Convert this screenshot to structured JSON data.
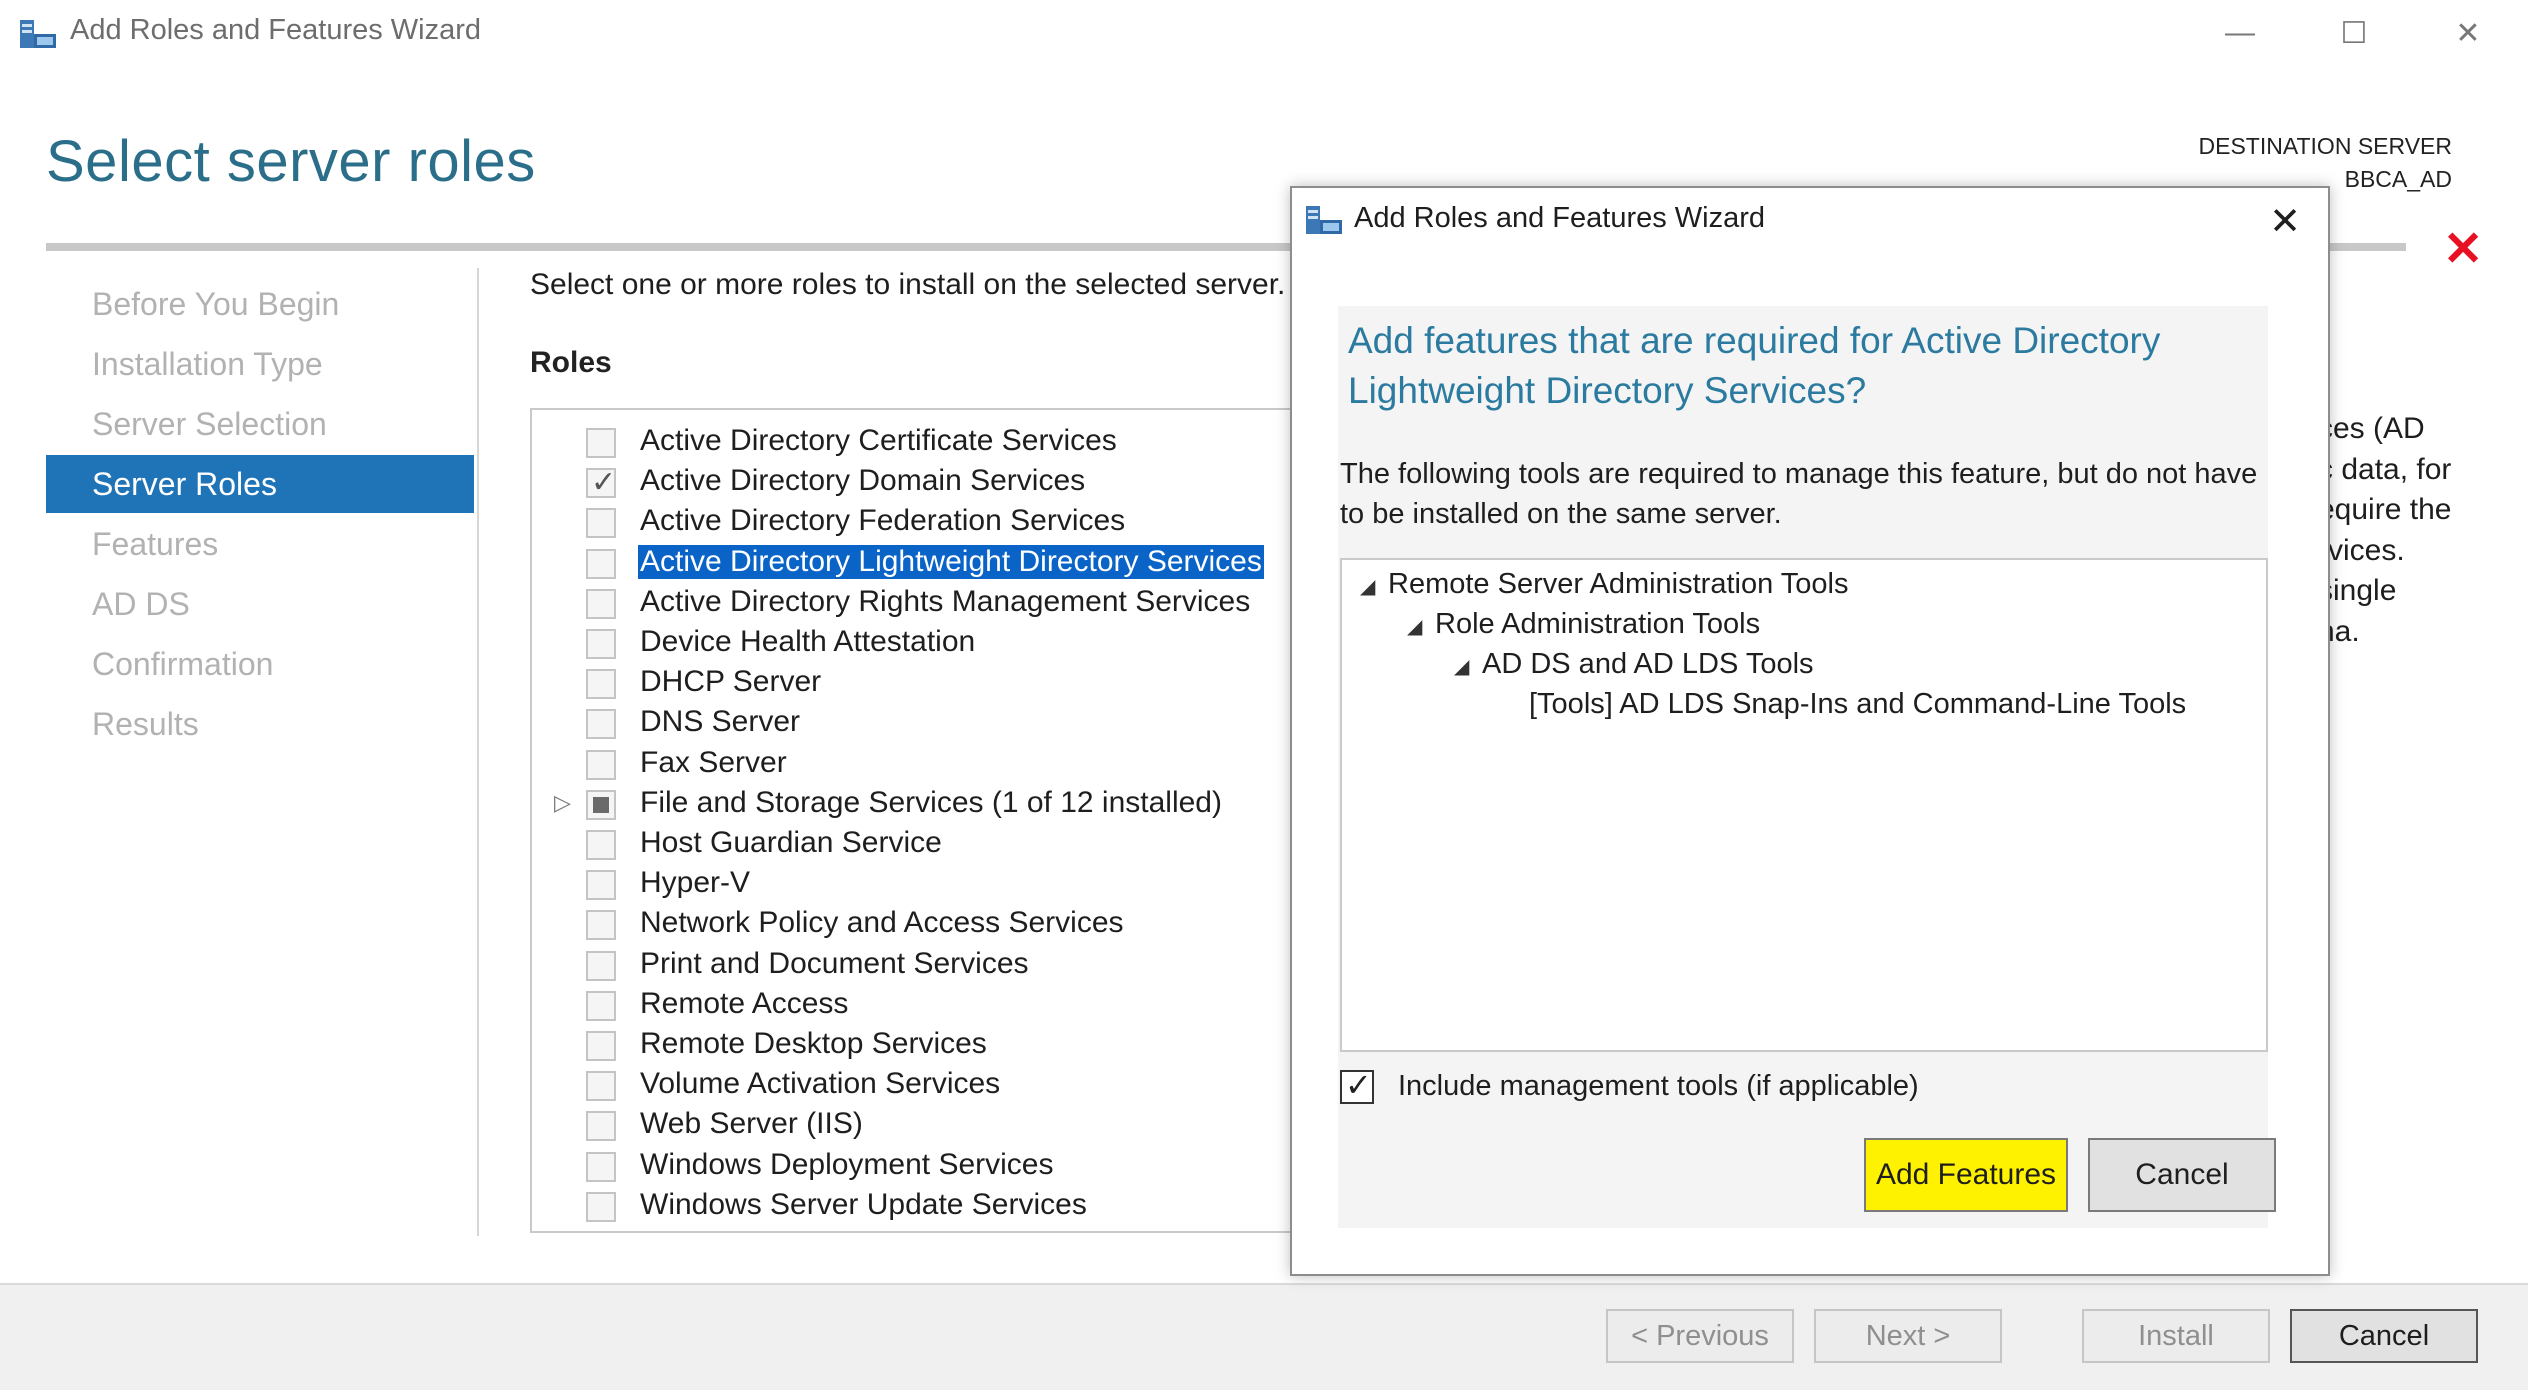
{
  "window": {
    "title": "Add Roles and Features Wizard",
    "minimize": "—",
    "maximize": "☐",
    "close": "✕"
  },
  "header": {
    "page_title": "Select server roles",
    "destination_label": "DESTINATION SERVER",
    "destination_server": "BBCA_AD",
    "error_icon": "red-x-icon"
  },
  "nav": {
    "items": [
      {
        "label": "Before You Begin",
        "active": false
      },
      {
        "label": "Installation Type",
        "active": false
      },
      {
        "label": "Server Selection",
        "active": false
      },
      {
        "label": "Server Roles",
        "active": true
      },
      {
        "label": "Features",
        "active": false
      },
      {
        "label": "AD DS",
        "active": false
      },
      {
        "label": "Confirmation",
        "active": false
      },
      {
        "label": "Results",
        "active": false
      }
    ]
  },
  "main": {
    "instruction": "Select one or more roles to install on the selected server.",
    "roles_label": "Roles",
    "roles": [
      {
        "label": "Active Directory Certificate Services",
        "state": "unchecked"
      },
      {
        "label": "Active Directory Domain Services",
        "state": "checked"
      },
      {
        "label": "Active Directory Federation Services",
        "state": "unchecked"
      },
      {
        "label": "Active Directory Lightweight Directory Services",
        "state": "unchecked",
        "selected": true
      },
      {
        "label": "Active Directory Rights Management Services",
        "state": "unchecked"
      },
      {
        "label": "Device Health Attestation",
        "state": "unchecked"
      },
      {
        "label": "DHCP Server",
        "state": "unchecked"
      },
      {
        "label": "DNS Server",
        "state": "unchecked"
      },
      {
        "label": "Fax Server",
        "state": "unchecked"
      },
      {
        "label": "File and Storage Services (1 of 12 installed)",
        "state": "partial",
        "expandable": true
      },
      {
        "label": "Host Guardian Service",
        "state": "unchecked"
      },
      {
        "label": "Hyper-V",
        "state": "unchecked"
      },
      {
        "label": "Network Policy and Access Services",
        "state": "unchecked"
      },
      {
        "label": "Print and Document Services",
        "state": "unchecked"
      },
      {
        "label": "Remote Access",
        "state": "unchecked"
      },
      {
        "label": "Remote Desktop Services",
        "state": "unchecked"
      },
      {
        "label": "Volume Activation Services",
        "state": "unchecked"
      },
      {
        "label": "Web Server (IIS)",
        "state": "unchecked"
      },
      {
        "label": "Windows Deployment Services",
        "state": "unchecked"
      },
      {
        "label": "Windows Server Update Services",
        "state": "unchecked"
      }
    ],
    "description_fragments": [
      "ces (AD",
      "c data, for",
      "equire the",
      "rvices.",
      "single",
      "na."
    ]
  },
  "footer": {
    "previous": "< Previous",
    "next": "Next >",
    "install": "Install",
    "cancel": "Cancel"
  },
  "modal": {
    "title": "Add Roles and Features Wizard",
    "close": "✕",
    "heading": "Add features that are required for Active Directory Lightweight Directory Services?",
    "description": "The following tools are required to manage this feature, but do not have to be installed on the same server.",
    "tree": [
      {
        "label": "Remote Server Administration Tools",
        "level": 0,
        "expanded": true
      },
      {
        "label": "Role Administration Tools",
        "level": 1,
        "expanded": true
      },
      {
        "label": "AD DS and AD LDS Tools",
        "level": 2,
        "expanded": true
      },
      {
        "label": "[Tools] AD LDS Snap-Ins and Command-Line Tools",
        "level": 3,
        "expanded": false
      }
    ],
    "include_tools_label": "Include management tools (if applicable)",
    "include_tools_checked": true,
    "add_features": "Add Features",
    "cancel": "Cancel",
    "highlight_color": "#fff200"
  },
  "colors": {
    "accent": "#1f73b7",
    "title_blue": "#2b6e89",
    "selection": "#0a64c8",
    "error_red": "#e81123"
  }
}
